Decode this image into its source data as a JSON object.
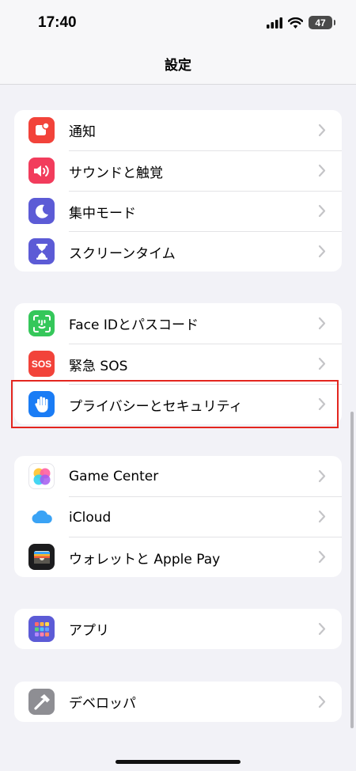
{
  "status": {
    "time": "17:40",
    "battery": "47"
  },
  "nav": {
    "title": "設定"
  },
  "groups": [
    [
      {
        "label": "通知",
        "icon": "notification-bell-icon",
        "color": "#f2433a"
      },
      {
        "label": "サウンドと触覚",
        "icon": "speaker-icon",
        "color": "#f23c5c"
      },
      {
        "label": "集中モード",
        "icon": "moon-icon",
        "color": "#5c5bd6"
      },
      {
        "label": "スクリーンタイム",
        "icon": "hourglass-icon",
        "color": "#5c5bd6"
      }
    ],
    [
      {
        "label": "Face IDとパスコード",
        "icon": "face-id-icon",
        "color": "#35c75a"
      },
      {
        "label": "緊急 SOS",
        "icon": "sos-icon",
        "color": "#f2433a",
        "icon_text": "SOS"
      },
      {
        "label": "プライバシーとセキュリティ",
        "icon": "hand-icon",
        "color": "#1a7cf5"
      }
    ],
    [
      {
        "label": "Game Center",
        "icon": "game-center-icon",
        "color": "#ffffff"
      },
      {
        "label": "iCloud",
        "icon": "icloud-icon",
        "color": "#ffffff"
      },
      {
        "label": "ウォレットと Apple Pay",
        "icon": "wallet-icon",
        "color": "#1c1c1e"
      }
    ],
    [
      {
        "label": "アプリ",
        "icon": "apps-grid-icon",
        "color": "#5c5bd6"
      }
    ],
    [
      {
        "label": "デベロッパ",
        "icon": "hammer-icon",
        "color": "#8e8e93"
      }
    ]
  ]
}
